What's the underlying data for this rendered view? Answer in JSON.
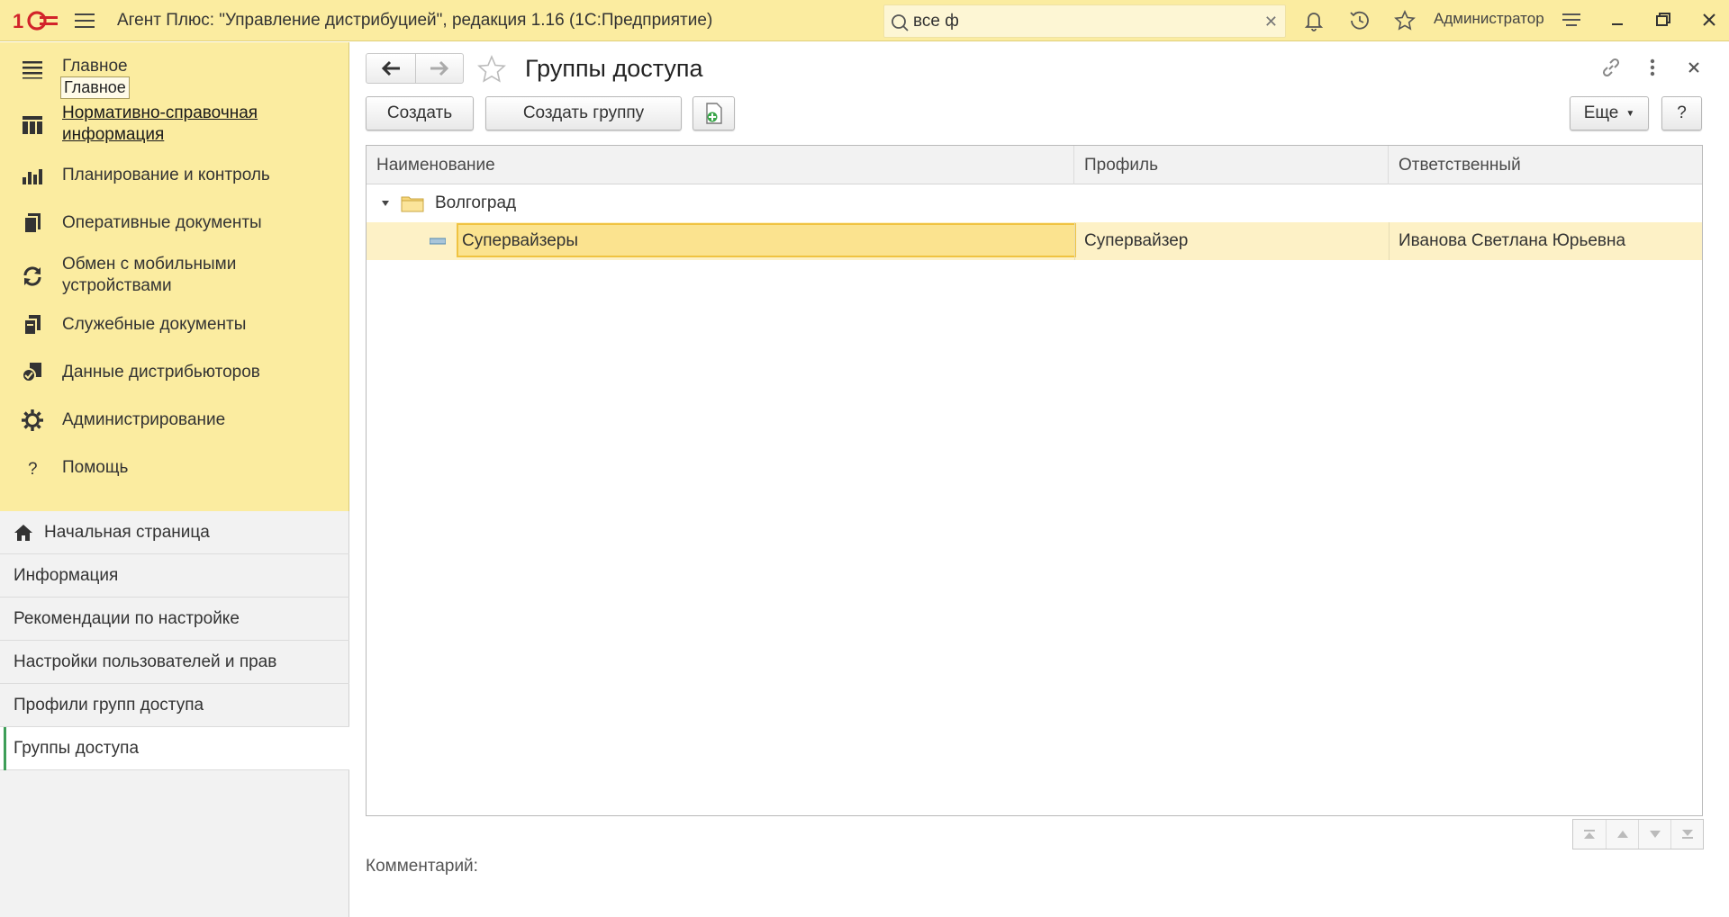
{
  "app": {
    "title": "Агент Плюс: \"Управление дистрибуцией\", редакция 1.16  (1С:Предприятие)",
    "logo_text": "1С",
    "search_value": "все ф",
    "user": "Администратор",
    "accent_color": "#fbeca0"
  },
  "sidebar": {
    "tooltip": "Главное",
    "sections": [
      {
        "label": "Главное",
        "icon": "menu-icon"
      },
      {
        "label": "Нормативно-справочная информация",
        "line1": "Нормативно-справочная",
        "line2": "информация",
        "icon": "catalog-icon"
      },
      {
        "label": "Планирование и контроль",
        "icon": "chart-icon"
      },
      {
        "label": "Оперативные документы",
        "icon": "documents-icon"
      },
      {
        "label": "Обмен с мобильными устройствами",
        "line1": "Обмен с мобильными",
        "line2": "устройствами",
        "icon": "sync-icon"
      },
      {
        "label": "Служебные документы",
        "icon": "service-documents-icon"
      },
      {
        "label": "Данные дистрибьюторов",
        "icon": "distributor-data-icon"
      },
      {
        "label": "Администрирование",
        "icon": "gear-icon"
      },
      {
        "label": "Помощь",
        "icon": "help-icon"
      }
    ],
    "nav": [
      {
        "label": "Начальная страница",
        "icon": "home-icon"
      },
      {
        "label": "Информация"
      },
      {
        "label": "Рекомендации по настройке"
      },
      {
        "label": "Настройки пользователей и прав"
      },
      {
        "label": "Профили групп доступа"
      },
      {
        "label": "Группы доступа",
        "active": true
      }
    ]
  },
  "main": {
    "page_title": "Группы доступа",
    "buttons": {
      "create": "Создать",
      "create_group": "Создать группу",
      "more": "Еще",
      "help": "?"
    },
    "table": {
      "columns": [
        "Наименование",
        "Профиль",
        "Ответственный"
      ],
      "group": {
        "name": "Волгоград"
      },
      "rows": [
        {
          "name": "Супервайзеры",
          "profile": "Супервайзер",
          "responsible": "Иванова Светлана Юрьевна",
          "selected": true
        }
      ]
    },
    "comment_label": "Комментарий:"
  }
}
